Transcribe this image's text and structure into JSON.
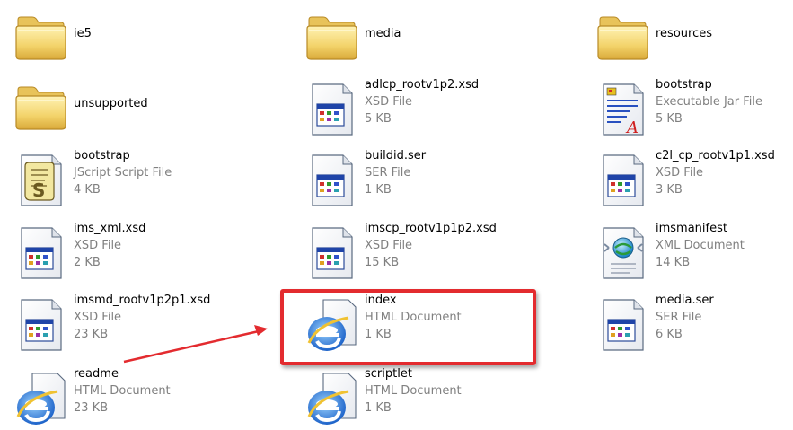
{
  "files": [
    {
      "name": "ie5",
      "type": "",
      "size": "",
      "icon": "folder-icon"
    },
    {
      "name": "media",
      "type": "",
      "size": "",
      "icon": "folder-icon"
    },
    {
      "name": "resources",
      "type": "",
      "size": "",
      "icon": "folder-icon"
    },
    {
      "name": "unsupported",
      "type": "",
      "size": "",
      "icon": "folder-icon"
    },
    {
      "name": "adlcp_rootv1p2.xsd",
      "type": "XSD File",
      "size": "5 KB",
      "icon": "xsd-file-icon"
    },
    {
      "name": "bootstrap",
      "type": "Executable Jar File",
      "size": "5 KB",
      "icon": "jar-file-icon"
    },
    {
      "name": "bootstrap",
      "type": "JScript Script File",
      "size": "4 KB",
      "icon": "script-file-icon"
    },
    {
      "name": "buildid.ser",
      "type": "SER File",
      "size": "1 KB",
      "icon": "ser-file-icon"
    },
    {
      "name": "c2l_cp_rootv1p1.xsd",
      "type": "XSD File",
      "size": "3 KB",
      "icon": "xsd-file-icon"
    },
    {
      "name": "ims_xml.xsd",
      "type": "XSD File",
      "size": "2 KB",
      "icon": "xsd-file-icon"
    },
    {
      "name": "imscp_rootv1p1p2.xsd",
      "type": "XSD File",
      "size": "15 KB",
      "icon": "xsd-file-icon"
    },
    {
      "name": "imsmanifest",
      "type": "XML Document",
      "size": "14 KB",
      "icon": "xml-document-icon"
    },
    {
      "name": "imsmd_rootv1p2p1.xsd",
      "type": "XSD File",
      "size": "23 KB",
      "icon": "xsd-file-icon"
    },
    {
      "name": "index",
      "type": "HTML Document",
      "size": "1 KB",
      "icon": "ie-html-icon"
    },
    {
      "name": "media.ser",
      "type": "SER File",
      "size": "6 KB",
      "icon": "ser-file-icon"
    },
    {
      "name": "readme",
      "type": "HTML Document",
      "size": "23 KB",
      "icon": "ie-html-icon"
    },
    {
      "name": "scriptlet",
      "type": "HTML Document",
      "size": "1 KB",
      "icon": "ie-html-icon"
    }
  ],
  "annotation": {
    "highlight_color": "#e32b2f",
    "arrow_color": "#e32b2f",
    "highlighted_file": "index"
  }
}
